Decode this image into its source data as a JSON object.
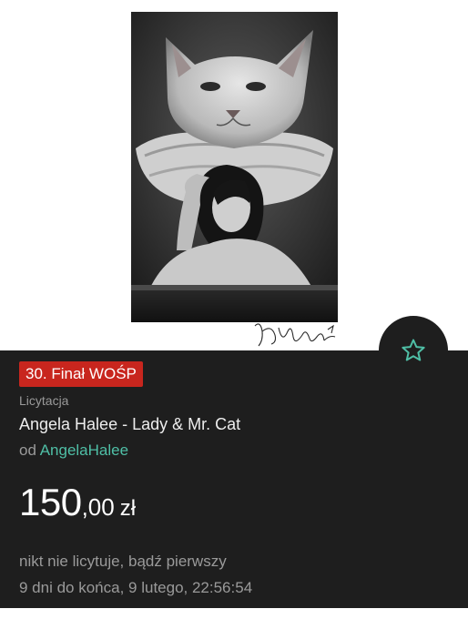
{
  "product": {
    "badge": "30. Finał WOŚP",
    "listing_type": "Licytacja",
    "title": "Angela Halee - Lady & Mr. Cat",
    "seller_prefix": "od ",
    "seller_name": "AngelaHalee",
    "price_main": "150",
    "price_fraction": ",00",
    "currency": "zł",
    "bid_status": "nikt nie licytuje, bądź pierwszy",
    "time_left": "9 dni do końca, 9 lutego, 22:56:54"
  },
  "icons": {
    "favorite": "star-outline-icon"
  },
  "colors": {
    "panel_background": "#1e1e1e",
    "badge_background": "#c8261e",
    "accent": "#4fbfa6",
    "secondary_text": "#9a9a9a"
  }
}
